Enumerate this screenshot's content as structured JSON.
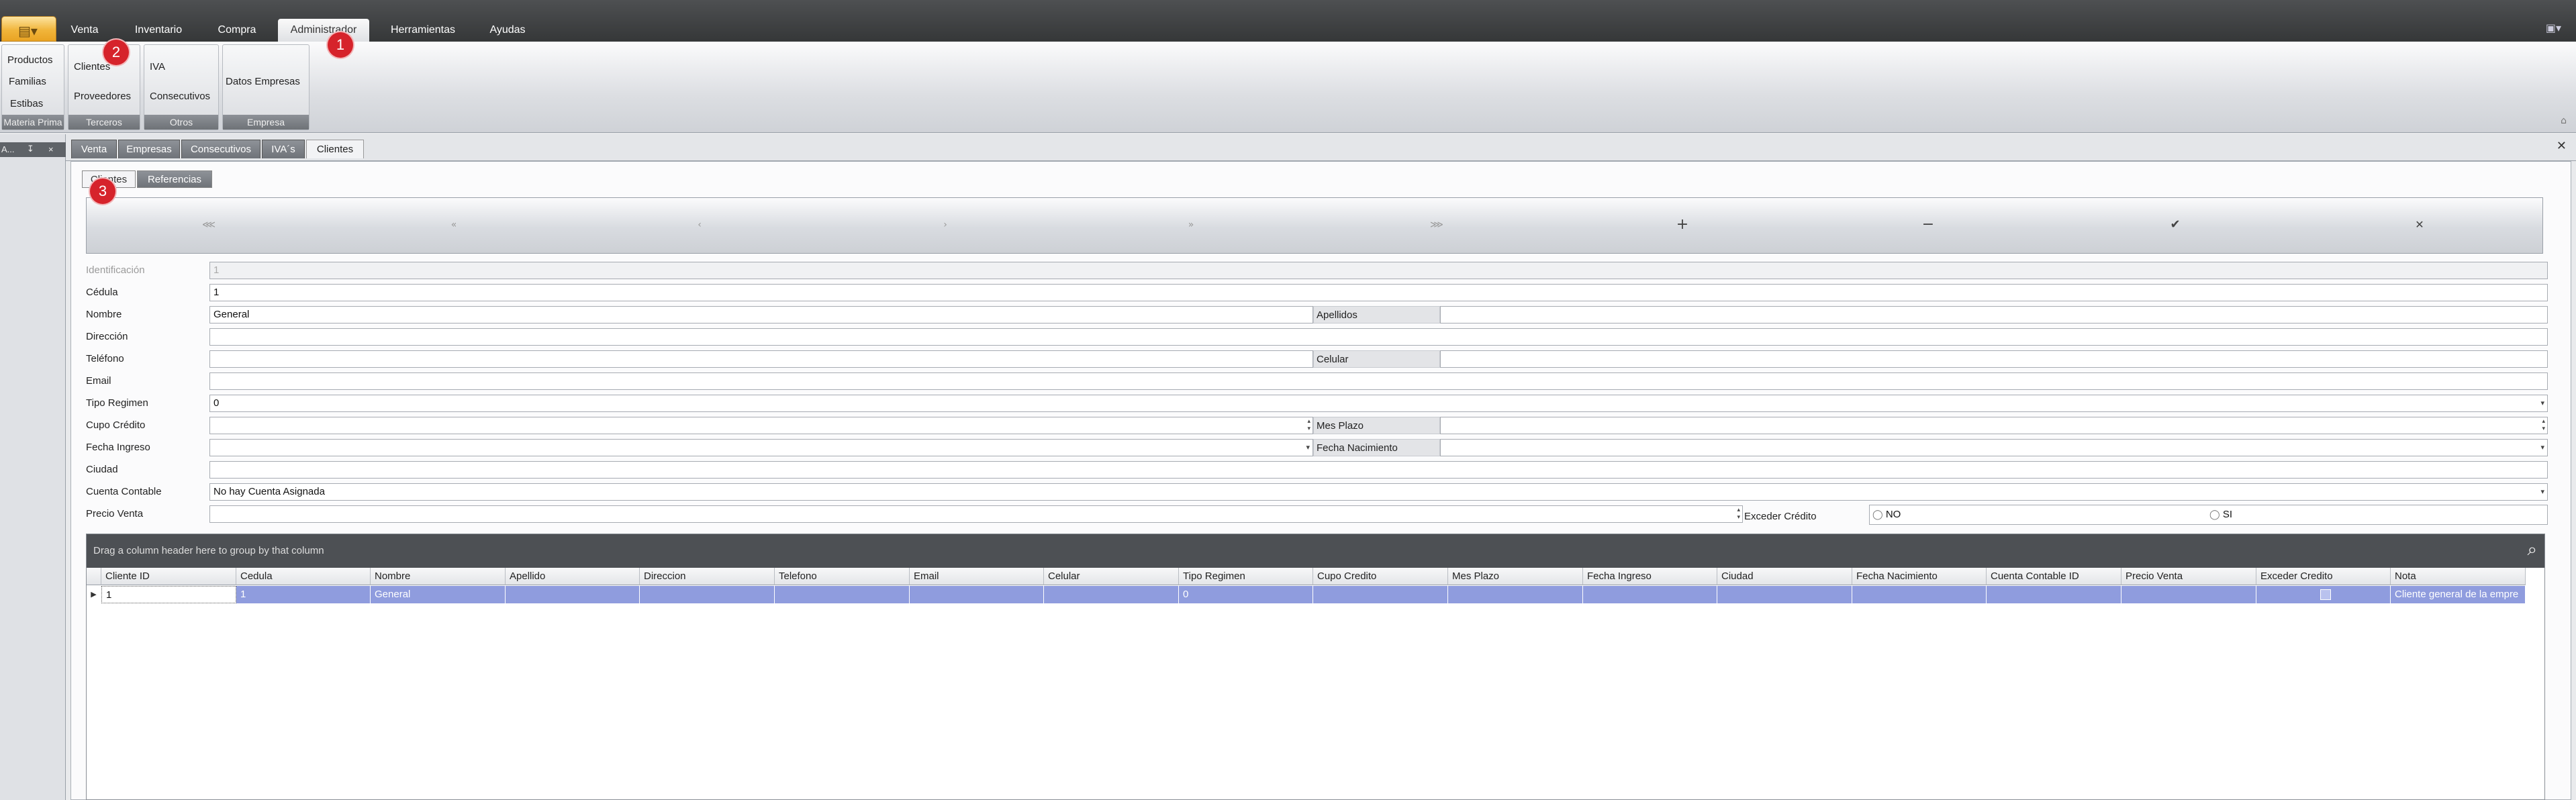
{
  "ribbon": {
    "app_button": "app-menu-icon",
    "tabs": [
      "Venta",
      "Inventario",
      "Compra",
      "Administrador",
      "Herramientas",
      "Ayudas"
    ],
    "active_tab": "Administrador",
    "groups": {
      "materia_prima": {
        "items": [
          "Productos",
          "Familias",
          "Estibas"
        ],
        "label": "Materia Prima"
      },
      "terceros": {
        "items": [
          "Clientes",
          "Proveedores"
        ],
        "label": "Terceros"
      },
      "otros": {
        "items": [
          "IVA",
          "Consecutivos"
        ],
        "label": "Otros"
      },
      "empresa": {
        "items": [
          "Datos Empresas"
        ],
        "label": "Empresa"
      }
    }
  },
  "markers": [
    "1",
    "2",
    "3"
  ],
  "left_dock": {
    "buttons": [
      "A...",
      "&#x2193;",
      "×"
    ]
  },
  "doc_tabs": [
    "Venta",
    "Empresas",
    "Consecutivos",
    "IVA´s",
    "Clientes"
  ],
  "active_doc_tab": "Clientes",
  "sub_tabs": [
    "Clientes",
    "Referencias"
  ],
  "navigator": {
    "buttons": [
      "first-icon",
      "prev-page-icon",
      "prev-icon",
      "next-icon",
      "next-page-icon",
      "last-icon",
      "add-icon",
      "remove-icon",
      "accept-icon",
      "cancel-icon"
    ],
    "glyphs": [
      "⋘",
      "«",
      "‹",
      "›",
      "»",
      "⋙",
      "+",
      "−",
      "✔",
      "✕"
    ]
  },
  "form": {
    "identificacion": {
      "label": "Identificación",
      "value": "1"
    },
    "cedula": {
      "label": "Cédula",
      "value": "1"
    },
    "nombre": {
      "label": "Nombre",
      "value": "General"
    },
    "apellidos": {
      "label": "Apellidos",
      "value": ""
    },
    "direccion": {
      "label": "Dirección",
      "value": ""
    },
    "telefono": {
      "label": "Teléfono",
      "value": ""
    },
    "celular": {
      "label": "Celular",
      "value": ""
    },
    "email": {
      "label": "Email",
      "value": ""
    },
    "tipo_regimen": {
      "label": "Tipo Regimen",
      "value": "0"
    },
    "cupo_credito": {
      "label": "Cupo Crédito",
      "value": ""
    },
    "mes_plazo": {
      "label": "Mes Plazo",
      "value": ""
    },
    "fecha_ingreso": {
      "label": "Fecha Ingreso",
      "value": ""
    },
    "fecha_nacimiento": {
      "label": "Fecha Nacimiento",
      "value": ""
    },
    "ciudad": {
      "label": "Ciudad",
      "value": ""
    },
    "cuenta_contable": {
      "label": "Cuenta Contable",
      "value": "No hay Cuenta Asignada"
    },
    "precio_venta": {
      "label": "Precio Venta",
      "value": ""
    },
    "exceder_credito": {
      "label": "Exceder Crédito",
      "options": [
        "NO",
        "SI"
      ]
    }
  },
  "grid": {
    "group_panel_text": "Drag a column header here to group by that column",
    "columns": [
      "Cliente ID",
      "Cedula",
      "Nombre",
      "Apellido",
      "Direccion",
      "Telefono",
      "Email",
      "Celular",
      "Tipo Regimen",
      "Cupo Credito",
      "Mes Plazo",
      "Fecha Ingreso",
      "Ciudad",
      "Fecha Nacimiento",
      "Cuenta Contable ID",
      "Precio Venta",
      "Exceder Credito",
      "Nota"
    ],
    "rows": [
      [
        "1",
        "1",
        "General",
        "",
        "",
        "",
        "",
        "",
        "0",
        "",
        "",
        "",
        "",
        "",
        "",
        "",
        "",
        "Cliente general de la empre"
      ]
    ]
  }
}
